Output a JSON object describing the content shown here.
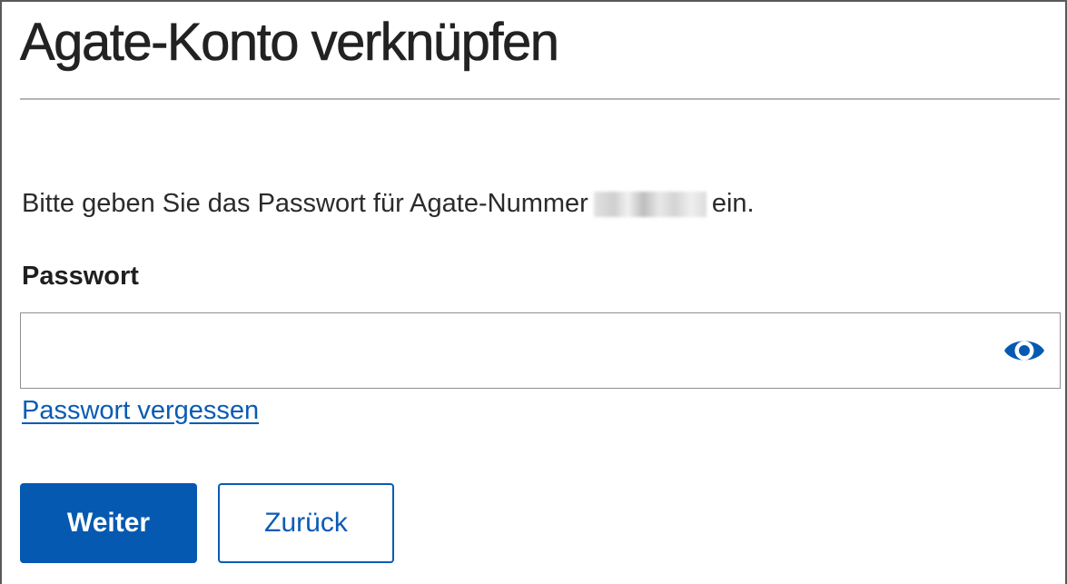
{
  "page": {
    "title": "Agate-Konto verknüpfen",
    "intro_prefix": "Bitte geben Sie das Passwort für Agate-Nummer",
    "intro_suffix": "ein."
  },
  "form": {
    "password_label": "Passwort",
    "password_value": "",
    "password_placeholder": "",
    "show_password_icon": "eye-icon",
    "forgot_link": "Passwort vergessen"
  },
  "actions": {
    "primary_label": "Weiter",
    "secondary_label": "Zurück"
  },
  "colors": {
    "accent": "#0559b0",
    "link": "#0a5bb5",
    "text": "#1a1a1a",
    "divider": "#b5b5b5",
    "field_border": "#8f8f8f"
  }
}
